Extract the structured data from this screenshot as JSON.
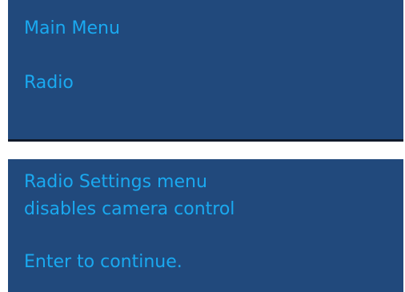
{
  "main_menu_panel": {
    "title": "Main Menu",
    "selected_item": "Radio"
  },
  "message_panel": {
    "line1": "Radio Settings menu",
    "line2": "disables camera control",
    "prompt": "Enter to continue."
  },
  "colors": {
    "panel_background": "#21497c",
    "text": "#1aa9f0",
    "page_background": "#ffffff"
  }
}
